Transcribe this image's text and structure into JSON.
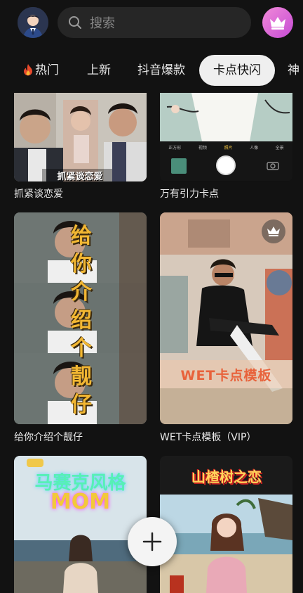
{
  "search": {
    "placeholder": "搜索"
  },
  "tabs": [
    {
      "label": "热门",
      "has_fire": true
    },
    {
      "label": "上新"
    },
    {
      "label": "抖音爆款"
    },
    {
      "label": "卡点快闪",
      "active": true
    },
    {
      "label": "神"
    }
  ],
  "cards": [
    {
      "caption": "抓紧谈恋爱",
      "overlay": "抓紧谈恋爱"
    },
    {
      "caption": "万有引力卡点",
      "camera_modes": [
        "正方形",
        "视频",
        "照片",
        "人像",
        "全景"
      ]
    },
    {
      "caption": "给你介绍个靓仔",
      "overlay_chars": [
        "给",
        "你",
        "介",
        "绍",
        "个",
        "靓",
        "仔"
      ]
    },
    {
      "caption": "WET卡点模板（VIP）",
      "overlay": "WET卡点模板",
      "vip": true
    },
    {
      "overlay": "马赛克风格",
      "overlay2": "MOM"
    },
    {
      "overlay": "山楂树之恋"
    }
  ],
  "colors": {
    "background": "#121212",
    "active_tab_bg": "#efefef",
    "vip_gradient_start": "#f18ad8",
    "vip_gradient_end": "#c64bd5"
  },
  "icons": [
    "avatar",
    "search-icon",
    "crown-icon",
    "fire-icon",
    "vip-crown-icon",
    "plus-icon"
  ]
}
